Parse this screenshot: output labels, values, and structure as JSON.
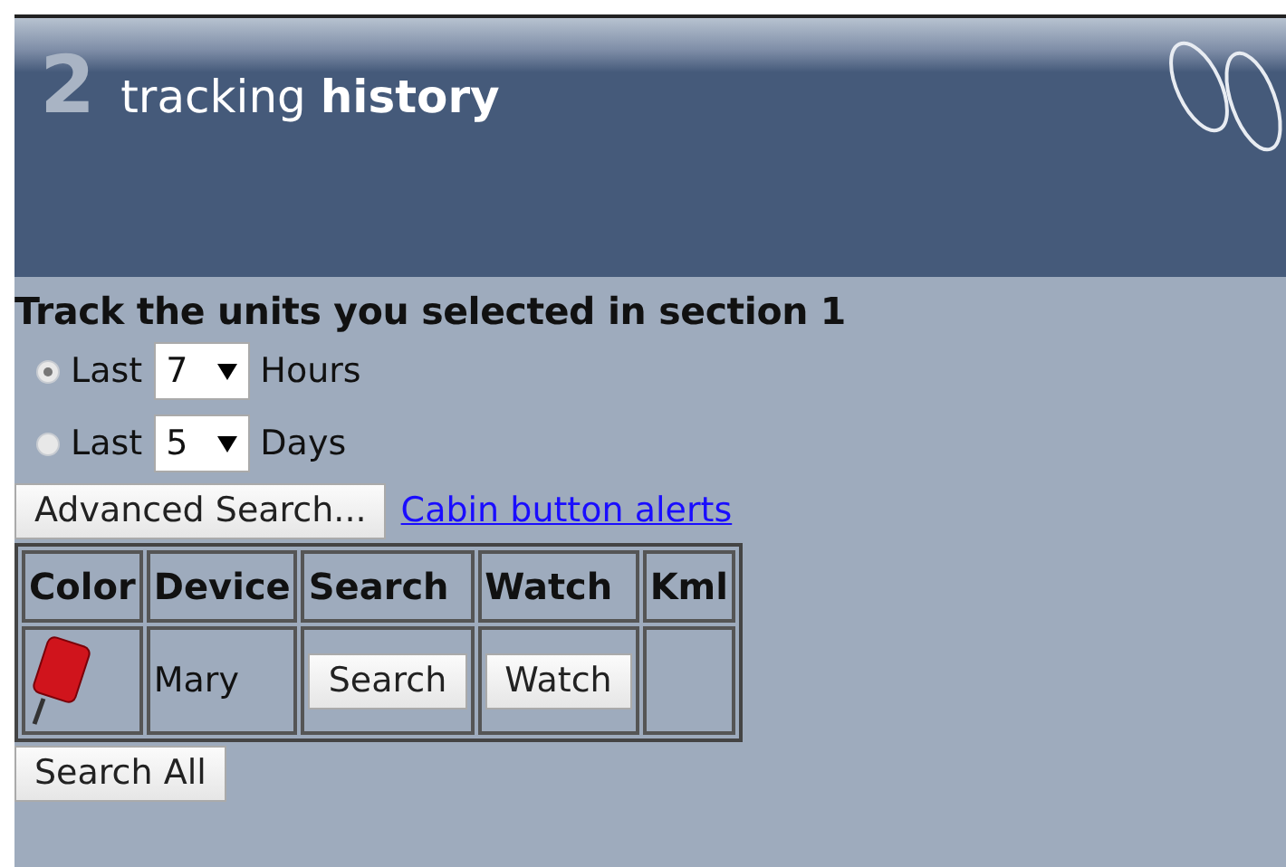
{
  "header": {
    "number": "2",
    "title_plain": "tracking",
    "title_bold": "history"
  },
  "heading": "Track the units you selected in section 1",
  "ranges": [
    {
      "label": "Last",
      "value": "7",
      "unit": "Hours",
      "selected": true
    },
    {
      "label": "Last",
      "value": "5",
      "unit": "Days",
      "selected": false
    }
  ],
  "advanced_button": "Advanced Search...",
  "alerts_link": "Cabin button alerts",
  "table": {
    "columns": [
      "Color",
      "Device",
      "Search",
      "Watch",
      "Kml"
    ],
    "rows": [
      {
        "color": "#d0141c",
        "device": "Mary",
        "search": "Search",
        "watch": "Watch"
      }
    ]
  },
  "search_all_button": "Search All"
}
